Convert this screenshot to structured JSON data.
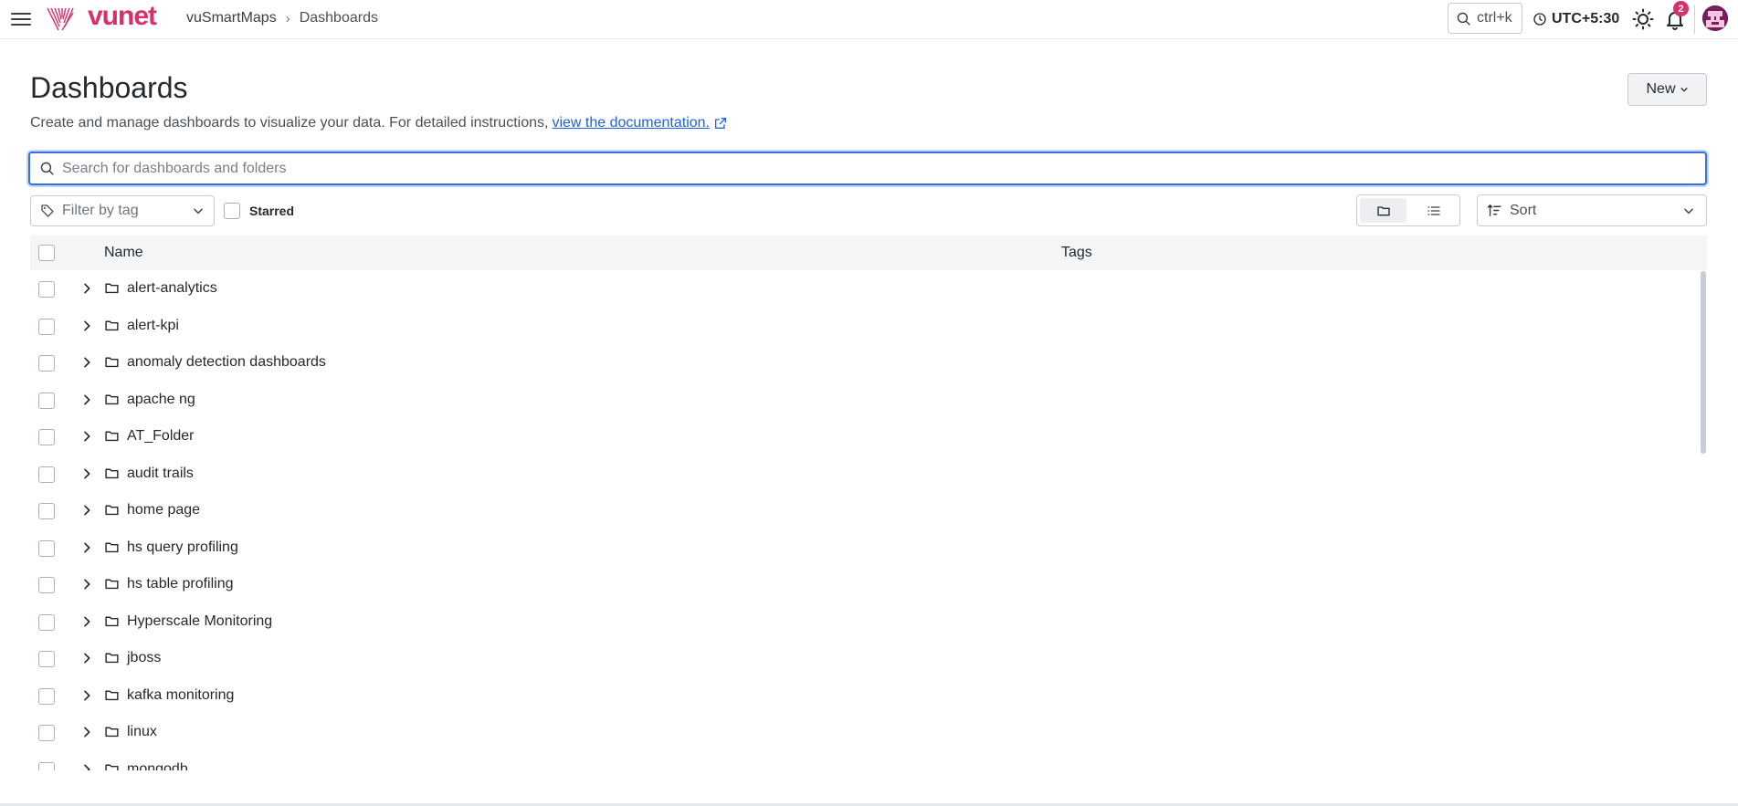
{
  "app": {
    "brand": "vunet",
    "colors": {
      "brand": "#d92f6b",
      "accent": "#3871dc",
      "link": "#1f62e0"
    }
  },
  "breadcrumb": {
    "root": "vuSmartMaps",
    "current": "Dashboards"
  },
  "topbar": {
    "command_search": "ctrl+k",
    "timezone": "UTC+5:30",
    "notifications_count": "2",
    "icons": [
      "menu-icon",
      "search-icon",
      "clock-icon",
      "sun-icon",
      "bell-icon"
    ]
  },
  "page": {
    "title": "Dashboards",
    "subtitle": "Create and manage dashboards to visualize your data. For detailed instructions,",
    "doc_link": "view the documentation.",
    "new_button": "New"
  },
  "search": {
    "placeholder": "Search for dashboards and folders",
    "value": ""
  },
  "filters": {
    "tag_placeholder": "Filter by tag",
    "starred_label": "Starred",
    "sort_label": "Sort",
    "view_mode": "folders"
  },
  "table": {
    "columns": [
      "Name",
      "Tags"
    ],
    "rows": [
      {
        "name": "alert-analytics"
      },
      {
        "name": "alert-kpi"
      },
      {
        "name": "anomaly detection dashboards"
      },
      {
        "name": "apache ng"
      },
      {
        "name": "AT_Folder"
      },
      {
        "name": "audit trails"
      },
      {
        "name": "home page"
      },
      {
        "name": "hs query profiling"
      },
      {
        "name": "hs table profiling"
      },
      {
        "name": "Hyperscale Monitoring"
      },
      {
        "name": "jboss"
      },
      {
        "name": "kafka monitoring"
      },
      {
        "name": "linux"
      },
      {
        "name": "mongodb"
      }
    ]
  }
}
